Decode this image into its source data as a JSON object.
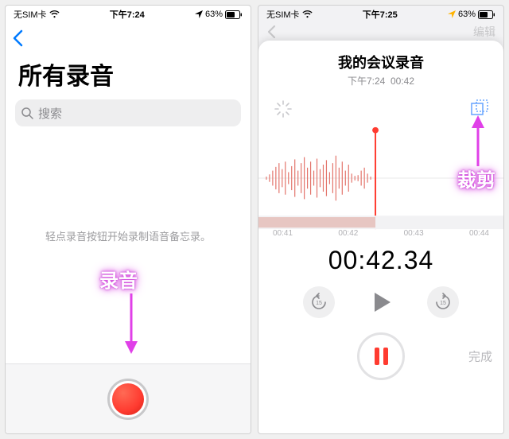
{
  "left": {
    "status": {
      "carrier": "无SIM卡",
      "time": "下午7:24",
      "battery": "63%"
    },
    "title": "所有录音",
    "search_placeholder": "搜索",
    "empty_hint": "轻点录音按钮开始录制语音备忘录。",
    "annotation": "录音"
  },
  "right": {
    "status": {
      "carrier": "无SIM卡",
      "time": "下午7:25",
      "battery": "63%"
    },
    "nav_edit": "编辑",
    "rec_title": "我的会议录音",
    "rec_time": "下午7:24",
    "rec_dur": "00:42",
    "ticks": [
      "00:41",
      "00:42",
      "00:43",
      "00:44"
    ],
    "big_time": "00:42.34",
    "skip_amount": "15",
    "done": "完成",
    "annotation": "裁剪"
  },
  "colors": {
    "accent_red": "#ff3b30",
    "ios_blue": "#007aff",
    "annotation_glow": "#d84fe0"
  }
}
